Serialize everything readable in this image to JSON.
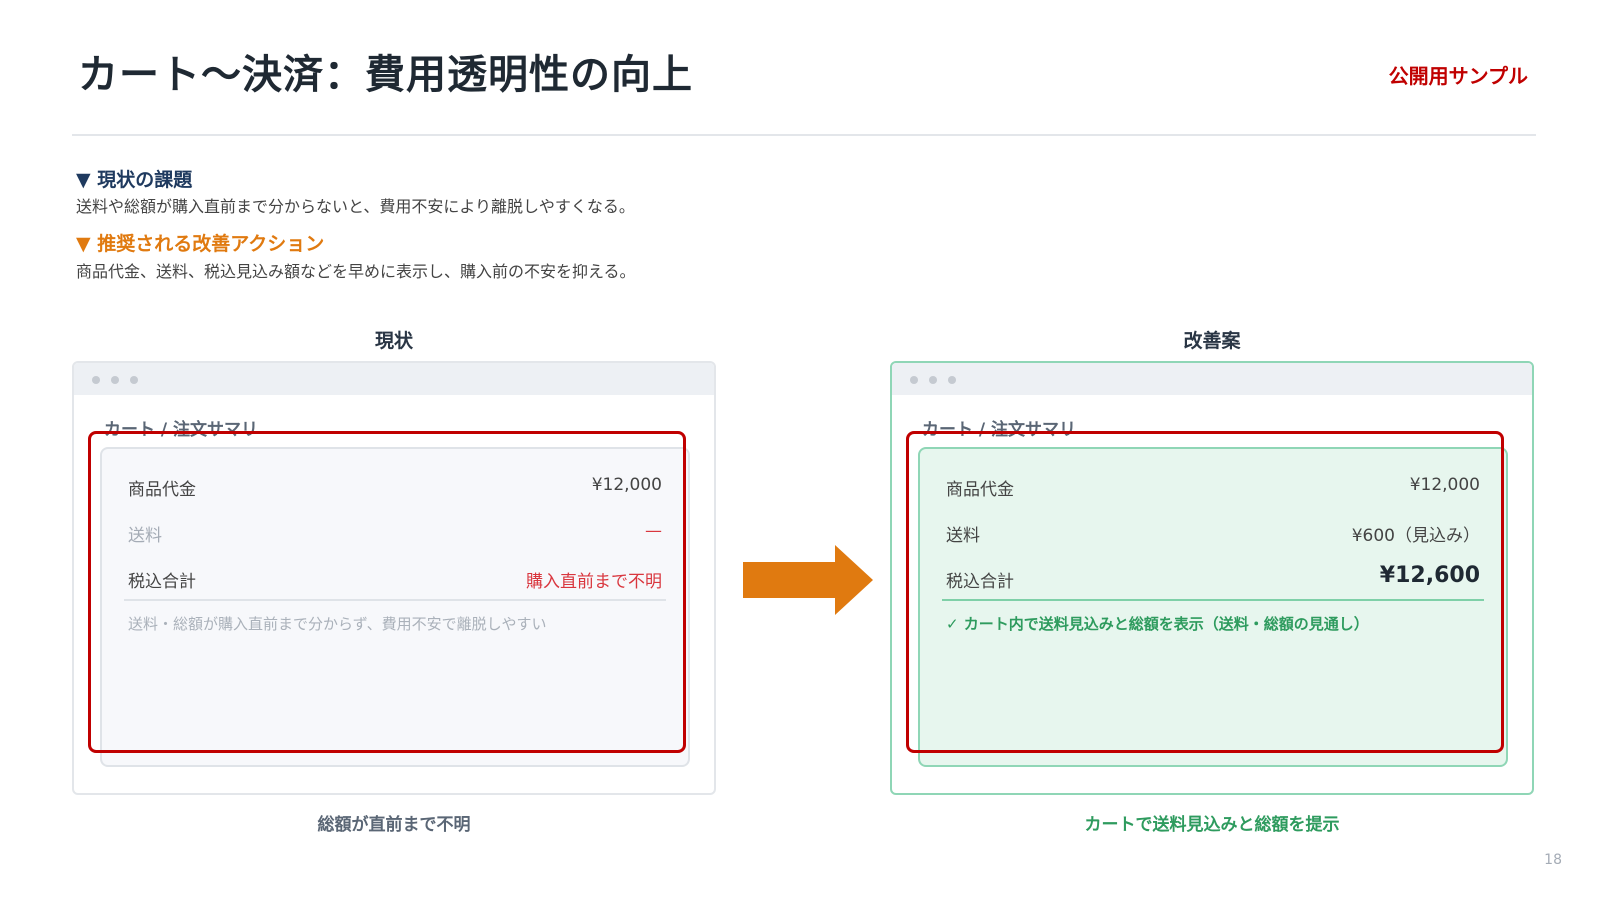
{
  "slide": {
    "title": "カート〜決済：費用透明性の向上",
    "sample_tag": "公開用サンプル",
    "page_number": "18"
  },
  "sections": {
    "issue_heading": "▼ 現状の課題",
    "issue_text": "送料や総額が購入直前まで分からないと、費用不安により離脱しやすくなる。",
    "action_heading": "▼ 推奨される改善アクション",
    "action_text": "商品代金、送料、税込見込み額などを早めに表示し、購入前の不安を抑える。"
  },
  "current": {
    "label": "現状",
    "window_heading": "カート / 注文サマリ",
    "rows": [
      {
        "key": "商品代金",
        "value": "¥12,000"
      },
      {
        "key": "送料",
        "value": "—"
      },
      {
        "key": "税込合計",
        "value": "購入直前まで不明"
      }
    ],
    "note": "送料・総額が購入直前まで分からず、費用不安で離脱しやすい",
    "caption": "総額が直前まで不明"
  },
  "proposal": {
    "label": "改善案",
    "window_heading": "カート / 注文サマリ",
    "rows": [
      {
        "key": "商品代金",
        "value": "¥12,000"
      },
      {
        "key": "送料",
        "value": "¥600（見込み）"
      },
      {
        "key": "税込合計",
        "value": "¥12,600"
      }
    ],
    "note": "✓ カート内で送料見込みと総額を表示（送料・総額の見通し）",
    "caption": "カートで送料見込みと総額を提示"
  },
  "colors": {
    "accent_red": "#c00000",
    "accent_orange": "#e07a10",
    "accent_green": "#2e9b5e",
    "navy": "#1f3a5f"
  }
}
